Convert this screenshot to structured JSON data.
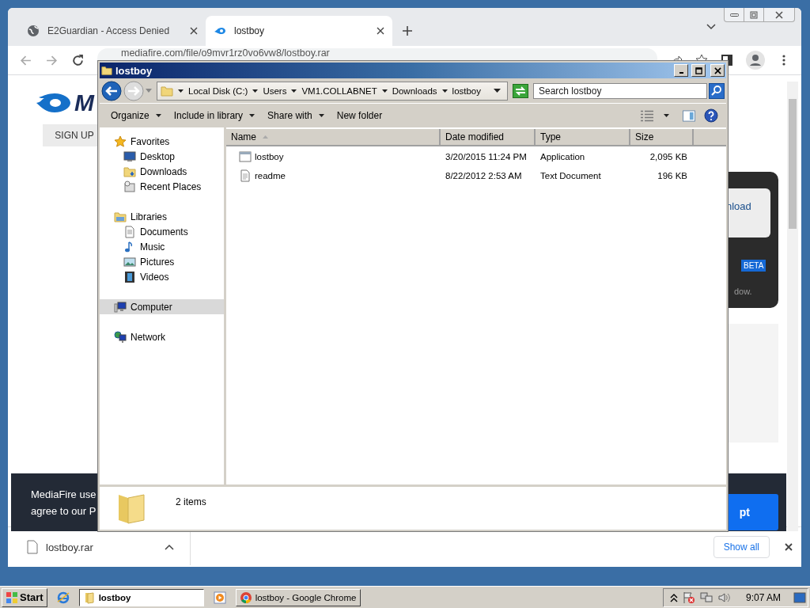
{
  "browser": {
    "tabs": [
      {
        "title": "E2Guardian - Access Denied",
        "kind": "globe",
        "selected": false
      },
      {
        "title": "lostboy",
        "kind": "flame",
        "selected": true
      }
    ],
    "url": "mediafire.com/file/o9mvr1rz0vo6vw8/lostboy.rar",
    "page": {
      "logo_text": "M",
      "signup": "SIGN UP",
      "card_button": "nload",
      "badge": "BETA",
      "card_note": "dow.",
      "cookie_lines": [
        "MediaFire use",
        "agree to our P"
      ],
      "cookie_button": "pt"
    },
    "download_bar": {
      "file": "lostboy.rar",
      "show_all": "Show all"
    }
  },
  "explorer": {
    "title": "lostboy",
    "breadcrumb": [
      "Local Disk (C:)",
      "Users",
      "VM1.COLLABNET",
      "Downloads",
      "lostboy"
    ],
    "search": {
      "placeholder": "Search lostboy"
    },
    "toolbar": [
      {
        "label": "Organize",
        "dropdown": true
      },
      {
        "label": "Include in library",
        "dropdown": true
      },
      {
        "label": "Share with",
        "dropdown": true
      },
      {
        "label": "New folder",
        "dropdown": false
      }
    ],
    "nav": [
      {
        "label": "Favorites",
        "kind": "star",
        "selected": false,
        "children": [
          {
            "label": "Desktop",
            "kind": "desktop",
            "selected": false
          },
          {
            "label": "Downloads",
            "kind": "downloads",
            "selected": false
          },
          {
            "label": "Recent Places",
            "kind": "recent",
            "selected": false
          }
        ]
      },
      {
        "label": "Libraries",
        "kind": "libraries",
        "selected": false,
        "children": [
          {
            "label": "Documents",
            "kind": "documents",
            "selected": false
          },
          {
            "label": "Music",
            "kind": "music",
            "selected": false
          },
          {
            "label": "Pictures",
            "kind": "pictures",
            "selected": false
          },
          {
            "label": "Videos",
            "kind": "videos",
            "selected": false
          }
        ]
      },
      {
        "label": "Computer",
        "kind": "computer",
        "selected": true
      },
      {
        "label": "Network",
        "kind": "network",
        "selected": false
      }
    ],
    "columns": [
      {
        "label": "Name",
        "sorted": true
      },
      {
        "label": "Date modified",
        "sorted": false
      },
      {
        "label": "Type",
        "sorted": false
      },
      {
        "label": "Size",
        "sorted": false
      }
    ],
    "files": [
      {
        "name": "lostboy",
        "date": "3/20/2015 11:24 PM",
        "type": "Application",
        "size": "2,095 KB",
        "kind": "app"
      },
      {
        "name": "readme",
        "date": "8/22/2012 2:53 AM",
        "type": "Text Document",
        "size": "196 KB",
        "kind": "text"
      }
    ],
    "status": "2 items"
  },
  "taskbar": {
    "start": "Start",
    "tasks": [
      {
        "label": "lostboy",
        "kind": "folder",
        "selected": true
      },
      {
        "label": "lostboy - Google Chrome",
        "kind": "chrome",
        "selected": false
      }
    ],
    "clock": "9:07 AM"
  }
}
